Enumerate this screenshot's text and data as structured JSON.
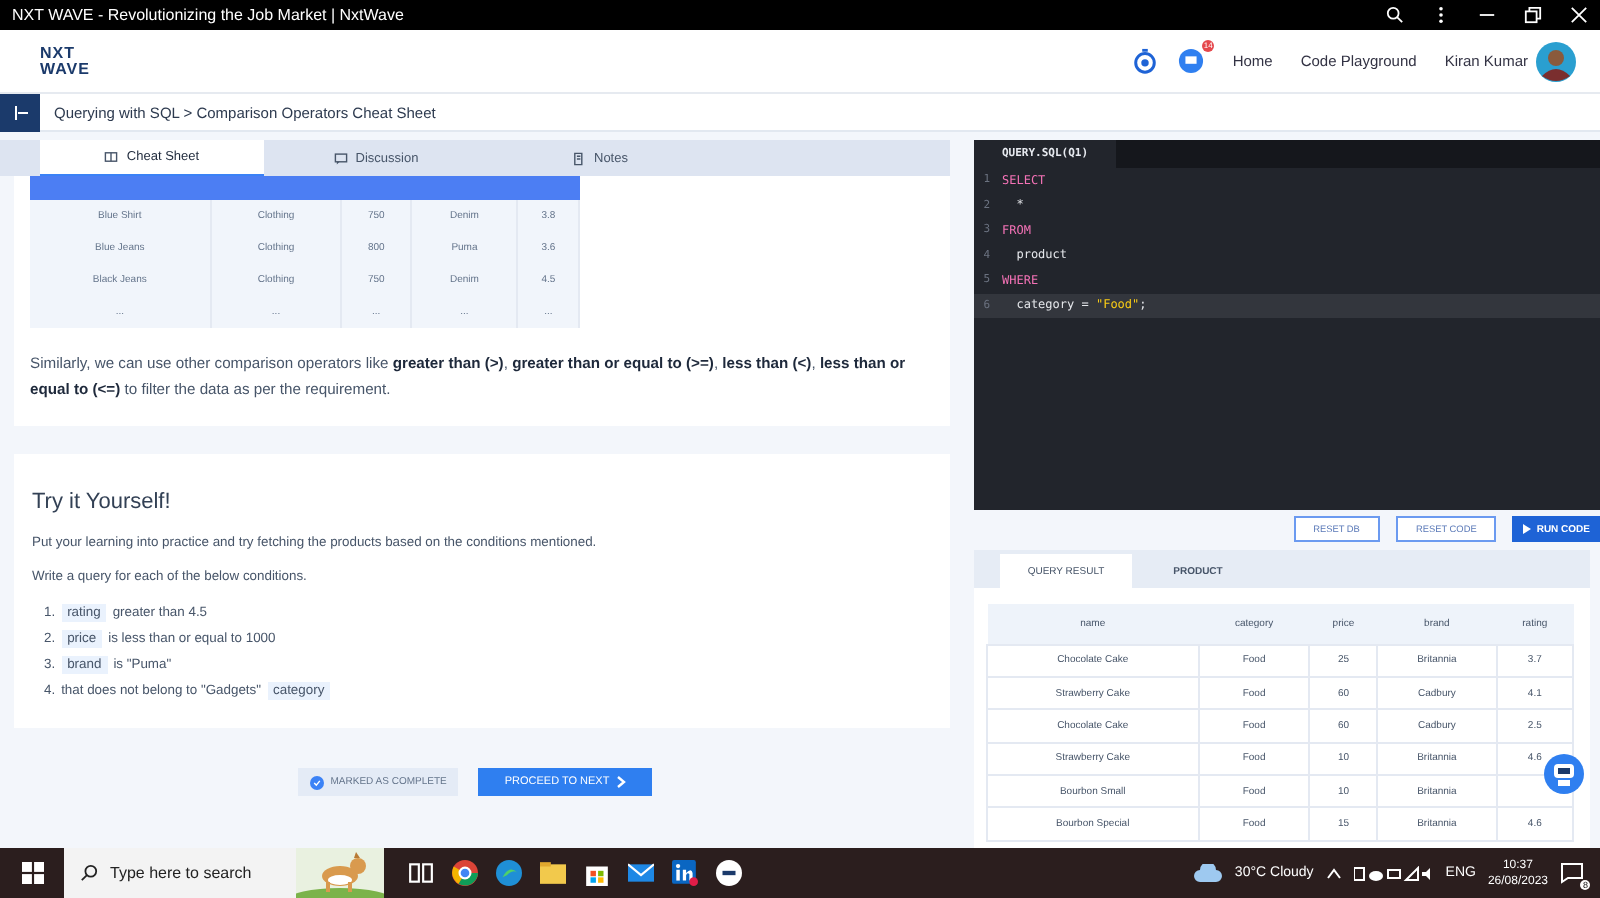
{
  "window": {
    "title": "NXT WAVE - Revolutionizing the Job Market | NxtWave"
  },
  "header": {
    "logo_top": "NXT",
    "logo_bottom": "WAVE",
    "notification_count": "14",
    "links": [
      "Home",
      "Code Playground"
    ],
    "user": "Kiran Kumar"
  },
  "breadcrumb": "Querying with SQL > Comparison Operators Cheat Sheet",
  "tabs": [
    {
      "label": "Cheat Sheet",
      "selected": true
    },
    {
      "label": "Discussion",
      "selected": false
    },
    {
      "label": "Notes",
      "selected": false
    }
  ],
  "sample_table": {
    "rows": [
      [
        "Blue Shirt",
        "Clothing",
        "750",
        "Denim",
        "3.8"
      ],
      [
        "Blue Jeans",
        "Clothing",
        "800",
        "Puma",
        "3.6"
      ],
      [
        "Black Jeans",
        "Clothing",
        "750",
        "Denim",
        "4.5"
      ],
      [
        "...",
        "...",
        "...",
        "...",
        "..."
      ]
    ]
  },
  "paragraph": "Similarly, we can use other comparison operators like **greater than (>)**, **greater than or equal to (>=)**, **less than (<)**, **less than or equal to (<=)** to filter the data as per the requirement.",
  "exercise": {
    "title": "Try it Yourself!",
    "intro": "Put your learning into practice and try fetching the products based on the conditions mentioned.",
    "instruction": "Write a query for each of the below conditions.",
    "items": [
      {
        "number": "1.",
        "parts": [
          {
            "kind": "code",
            "text": "rating"
          },
          {
            "kind": "text",
            "text": "greater than 4.5"
          }
        ]
      },
      {
        "number": "2.",
        "parts": [
          {
            "kind": "code",
            "text": "price"
          },
          {
            "kind": "text",
            "text": "is less than or equal to 1000"
          }
        ]
      },
      {
        "number": "3.",
        "parts": [
          {
            "kind": "code",
            "text": "brand"
          },
          {
            "kind": "text",
            "text": "is \"Puma\""
          }
        ]
      },
      {
        "number": "4.",
        "parts": [
          {
            "kind": "text",
            "text": "that does not belong to \"Gadgets\""
          },
          {
            "kind": "code",
            "text": "category"
          }
        ]
      }
    ]
  },
  "actions": {
    "complete": "MARKED AS COMPLETE",
    "next": "PROCEED TO NEXT"
  },
  "editor": {
    "file": "QUERY.SQL(Q1)",
    "lines": [
      {
        "number": "1",
        "current": false,
        "tokens": [
          {
            "kind": "keyword",
            "text": "SELECT"
          }
        ]
      },
      {
        "number": "2",
        "current": false,
        "tokens": [
          {
            "kind": "plain",
            "text": "  *"
          }
        ]
      },
      {
        "number": "3",
        "current": false,
        "tokens": [
          {
            "kind": "keyword",
            "text": "FROM"
          }
        ]
      },
      {
        "number": "4",
        "current": false,
        "tokens": [
          {
            "kind": "plain",
            "text": "  product"
          }
        ]
      },
      {
        "number": "5",
        "current": false,
        "tokens": [
          {
            "kind": "keyword",
            "text": "WHERE"
          }
        ]
      },
      {
        "number": "6",
        "current": true,
        "tokens": [
          {
            "kind": "plain",
            "text": "  category = "
          },
          {
            "kind": "string",
            "text": "\"Food\""
          },
          {
            "kind": "plain",
            "text": ";"
          }
        ]
      }
    ]
  },
  "editor_buttons": [
    "RESET DB",
    "RESET CODE",
    "RUN CODE"
  ],
  "result_tabs": [
    {
      "label": "QUERY RESULT",
      "selected": true
    },
    {
      "label": "PRODUCT",
      "selected": false
    }
  ],
  "result_table": {
    "columns": [
      "name",
      "category",
      "price",
      "brand",
      "rating"
    ],
    "rows": [
      [
        "Chocolate Cake",
        "Food",
        "25",
        "Britannia",
        "3.7"
      ],
      [
        "Strawberry Cake",
        "Food",
        "60",
        "Cadbury",
        "4.1"
      ],
      [
        "Chocolate Cake",
        "Food",
        "60",
        "Cadbury",
        "2.5"
      ],
      [
        "Strawberry Cake",
        "Food",
        "10",
        "Britannia",
        "4.6"
      ],
      [
        "Bourbon Small",
        "Food",
        "10",
        "Britannia",
        ""
      ],
      [
        "Bourbon Special",
        "Food",
        "15",
        "Britannia",
        "4.6"
      ]
    ]
  },
  "taskbar": {
    "search_placeholder": "Type here to search",
    "weather": "30°C Cloudy",
    "language": "ENG",
    "time": "10:37",
    "date": "26/08/2023",
    "notifications": "8"
  }
}
